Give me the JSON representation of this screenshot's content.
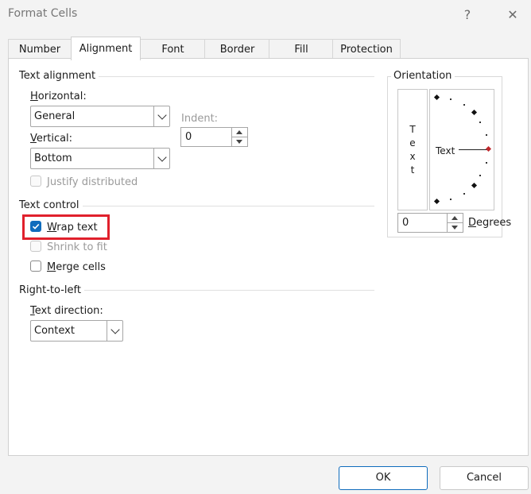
{
  "window": {
    "title": "Format Cells",
    "help_glyph": "?",
    "close_glyph": "✕"
  },
  "tabs": [
    {
      "label": "Number",
      "active": false
    },
    {
      "label": "Alignment",
      "active": true
    },
    {
      "label": "Font",
      "active": false
    },
    {
      "label": "Border",
      "active": false
    },
    {
      "label": "Fill",
      "active": false
    },
    {
      "label": "Protection",
      "active": false
    }
  ],
  "text_alignment": {
    "section_title": "Text alignment",
    "horizontal": {
      "label": "Horizontal:",
      "accel": "H",
      "rest": "orizontal:",
      "value": "General"
    },
    "vertical": {
      "label": "Vertical:",
      "accel": "V",
      "rest": "ertical:",
      "value": "Bottom"
    },
    "indent": {
      "label": "Indent:",
      "value": "0"
    },
    "justify_distributed": {
      "label": "Justify distributed",
      "checked": false,
      "enabled": false
    }
  },
  "text_control": {
    "section_title": "Text control",
    "wrap_text": {
      "label": "Wrap text",
      "accel": "W",
      "rest": "rap text",
      "checked": true,
      "highlighted": true
    },
    "shrink_to_fit": {
      "label": "Shrink to fit",
      "checked": false,
      "enabled": false
    },
    "merge_cells": {
      "label": "Merge cells",
      "accel": "M",
      "rest": "erge cells",
      "checked": false
    }
  },
  "right_to_left": {
    "section_title": "Right-to-left",
    "text_direction": {
      "label": "Text direction:",
      "accel": "T",
      "rest": "ext direction:",
      "value": "Context"
    }
  },
  "orientation": {
    "section_title": "Orientation",
    "vertical_letters": [
      "T",
      "e",
      "x",
      "t"
    ],
    "dial_label": "Text",
    "degrees": {
      "value": "0",
      "label": "Degrees",
      "accel": "D",
      "rest": "egrees"
    }
  },
  "buttons": {
    "ok": "OK",
    "cancel": "Cancel"
  },
  "colors": {
    "accent": "#0f6cbd",
    "highlight_border": "#e0202c",
    "dial_indicator": "#c0282c"
  }
}
